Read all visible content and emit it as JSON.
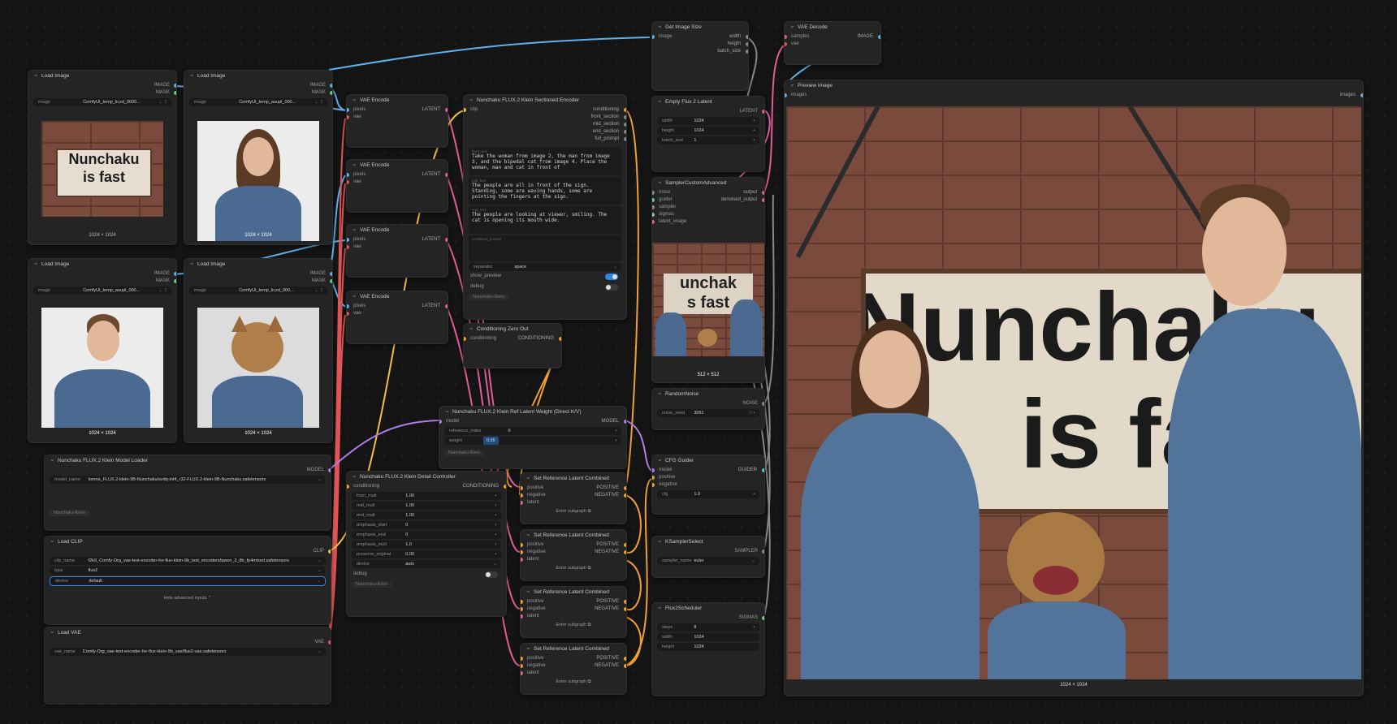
{
  "nodes": {
    "load1": {
      "title": "Load Image",
      "out1": "IMAGE",
      "out2": "MASK",
      "label": "image",
      "file": "ComfyUI_temp_liczd_0000...",
      "caption": "1024 × 1024",
      "sign1": "Nunchaku",
      "sign2": "is fast"
    },
    "load2": {
      "title": "Load Image",
      "out1": "IMAGE",
      "out2": "MASK",
      "label": "image",
      "file": "ComfyUI_temp_auupl_000...",
      "caption": "1024 × 1024"
    },
    "load3": {
      "title": "Load Image",
      "out1": "IMAGE",
      "out2": "MASK",
      "label": "image",
      "file": "ComfyUI_temp_auupl_000...",
      "caption": "1024 × 1024"
    },
    "load4": {
      "title": "Load Image",
      "out1": "IMAGE",
      "out2": "MASK",
      "label": "image",
      "file": "ComfyUI_temp_liczd_000...",
      "caption": "1024 × 1024"
    },
    "vae_enc": {
      "title": "VAE Encode",
      "in1": "pixels",
      "in2": "vae",
      "out": "LATENT"
    },
    "enc": {
      "title": "Nunchaku FLUX.2 Klein Sectioned Encoder",
      "in": "clip",
      "outs": [
        "conditioning",
        "front_section",
        "mid_section",
        "end_section",
        "full_prompt"
      ],
      "front_label": "front_text",
      "front_text": "Take the woman from image 2, the man from image 3, and the bipedal cat from image 4. Place the woman, man and cat in front of",
      "mid_label": "mid_text",
      "mid_text": "The people are all in front of the sign. Standing, some are waving hands, some are pointing the fingers at the sign.",
      "end_label": "end_text",
      "end_text": "The people are looking at viewer, smiling. The cat is opening its mouth wide.",
      "combined": "combined_prompt",
      "sep_label": "separator",
      "sep_val": "space",
      "preview": "show_preview",
      "debug": "debug",
      "chip": "Nunchaku-Klein"
    },
    "zero": {
      "title": "Conditioning Zero Out",
      "in": "conditioning",
      "out": "CONDITIONING"
    },
    "refw": {
      "title": "Nunchaku FLUX.2 Klein Ref Latent Weight (Direct K/V)",
      "in": "model",
      "out": "MODEL",
      "w1": "reference_index",
      "v1": "0",
      "w2": "weight",
      "v2": "0.95",
      "chip": "Nunchaku-Klein"
    },
    "loader": {
      "title": "Nunchaku FLUX.2 Klein Model Loader",
      "out": "MODEL",
      "label": "model_name",
      "val": "lorens_FLUX.2-klein-9B-Nunchaku/svdq-int4_r32-FLUX.2-klein-9B-Nunchaku.safetensors",
      "chip": "Nunchaku-Klein"
    },
    "clip": {
      "title": "Load CLIP",
      "out": "CLIP",
      "l1": "clip_name",
      "v1": "f2k9_Comfy-Org_vae-text-encoder-for-flux-klein-9b_text_encoders/qwen_3_8b_fp4mixed.safetensors",
      "l2": "type",
      "v2": "flux2",
      "l3": "device",
      "v3": "default",
      "hide": "Hide advanced inputs"
    },
    "vae": {
      "title": "Load VAE",
      "out": "VAE",
      "label": "vae_name",
      "val": "Comfy-Org_vae-text-encoder-for-flux-klein-9b_vae/flux2-vae.safetensors"
    },
    "detail": {
      "title": "Nunchaku FLUX.2 Klein Detail Controller",
      "in": "conditioning",
      "out": "CONDITIONING",
      "widgets": [
        [
          "front_mult",
          "1.00"
        ],
        [
          "mid_mult",
          "1.00"
        ],
        [
          "end_mult",
          "1.00"
        ],
        [
          "emphasis_start",
          "0"
        ],
        [
          "emphasis_end",
          "0"
        ],
        [
          "emphasis_mult",
          "1.0"
        ],
        [
          "preserve_original",
          "0.00"
        ]
      ],
      "device": "device",
      "device_val": "auto",
      "debug": "debug",
      "chip": "Nunchaku-Klein"
    },
    "setref": {
      "title": "Set Reference Latent Combined",
      "in1": "positive",
      "in2": "negative",
      "in3": "latent",
      "out1": "POSITIVE",
      "out2": "NEGATIVE",
      "sub": "Enter subgraph"
    },
    "getsize": {
      "title": "Get Image Size",
      "in": "image",
      "o1": "width",
      "o2": "height",
      "o3": "batch_size"
    },
    "empty": {
      "title": "Empty Flux 2 Latent",
      "out": "LATENT",
      "l1": "width",
      "v1": "1024",
      "l2": "height",
      "v2": "1024",
      "l3": "batch_size",
      "v3": "1"
    },
    "sampler": {
      "title": "SamplerCustomAdvanced",
      "ins": [
        "noise",
        "guider",
        "sampler",
        "sigmas",
        "latent_image"
      ],
      "o1": "output",
      "o2": "denoised_output",
      "caption": "512 × 512"
    },
    "noise": {
      "title": "RandomNoise",
      "out": "NOISE",
      "label": "noise_seed",
      "val": "3051"
    },
    "cfg": {
      "title": "CFG Guider",
      "ins": [
        "model",
        "positive",
        "negative"
      ],
      "out": "GUIDER",
      "label": "cfg",
      "val": "1.0"
    },
    "ksel": {
      "title": "KSamplerSelect",
      "out": "SAMPLER",
      "label": "sampler_name",
      "val": "euler"
    },
    "sched": {
      "title": "Flux2Scheduler",
      "out": "SIGMAS",
      "l1": "steps",
      "v1": "8",
      "l2": "width",
      "v2": "1024",
      "l3": "height",
      "v3": "1024"
    },
    "vaedec": {
      "title": "VAE Decode",
      "in1": "samples",
      "in2": "vae",
      "out": "IMAGE"
    },
    "preview": {
      "title": "Preview Image",
      "in": "images",
      "out": "images",
      "caption": "1024 × 1024",
      "sign1": "Nunchaku",
      "sign2": "is fast"
    }
  },
  "colors": {
    "image": "#5fb0e8",
    "mask": "#5ecc8a",
    "latent": "#e05d9a",
    "vae": "#e05555",
    "clip": "#f0c040",
    "cond": "#f0a030",
    "model": "#b07ce8",
    "accent": "#2a86e6"
  }
}
